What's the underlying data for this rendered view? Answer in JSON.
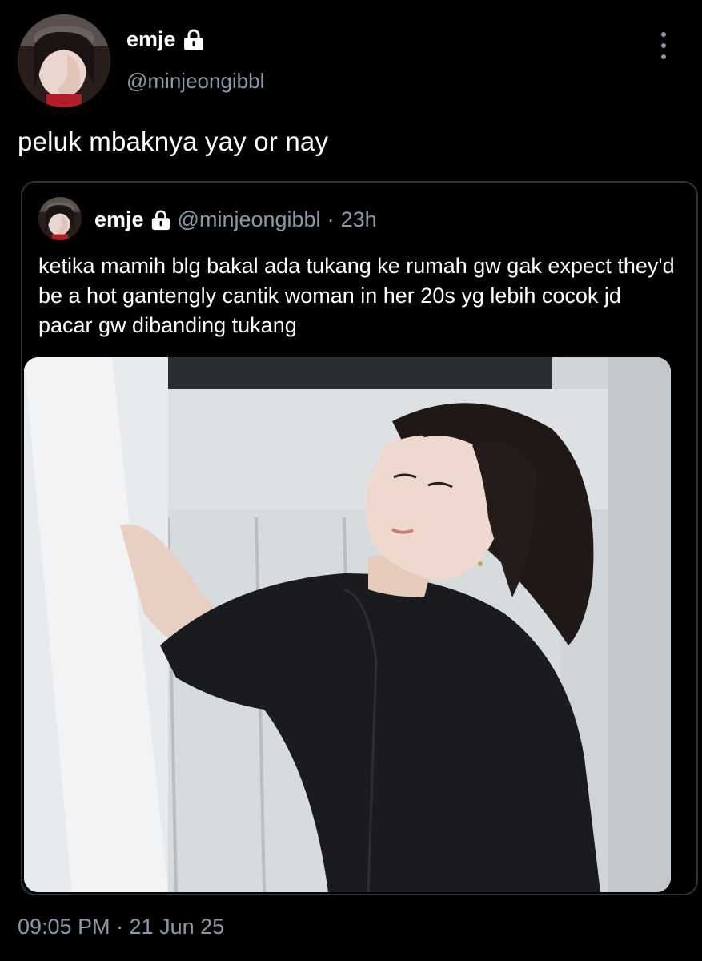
{
  "author": {
    "display_name": "emje",
    "handle": "@minjeongibbl",
    "locked_icon": "lock-icon",
    "avatar_icon": "profile-photo"
  },
  "menu_icon": "more-vertical-icon",
  "tweet": {
    "text": "peluk mbaknya yay or nay",
    "timestamp": "09:05 PM · 21 Jun 25"
  },
  "quoted": {
    "display_name": "emje",
    "handle": "@minjeongibbl",
    "separator": "·",
    "time": "23h",
    "text": "ketika mamih blg bakal ada tukang ke rumah gw gak expect they'd be a hot gantengly cantik woman in her 20s yg lebih cocok jd pacar gw dibanding tukang",
    "media": "photo"
  },
  "colors": {
    "background": "#000000",
    "text": "#ffffff",
    "secondary_text": "#8b98a5",
    "border": "#2f3336"
  }
}
